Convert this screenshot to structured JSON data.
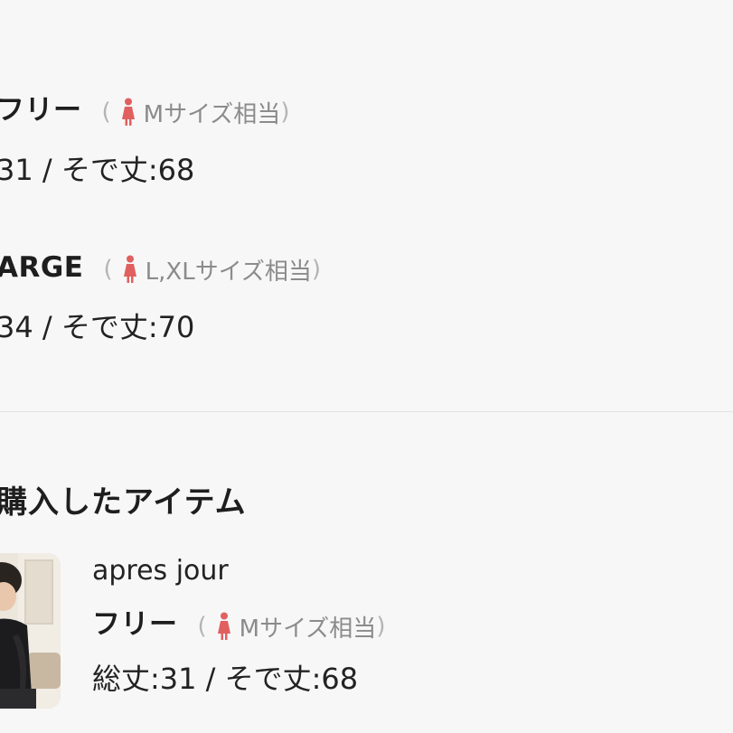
{
  "size_options": [
    {
      "name": "フリー",
      "equivalent_prefix": "(",
      "equivalent": "Mサイズ相当",
      "equivalent_suffix": ")",
      "measurements": "31 / そで丈:68"
    },
    {
      "name": "ARGE",
      "equivalent_prefix": "(",
      "equivalent": "L,XLサイズ相当",
      "equivalent_suffix": ")",
      "measurements": "34 / そで丈:70"
    }
  ],
  "purchased": {
    "section_title": "購入したアイテム",
    "item": {
      "brand": "apres jour",
      "size_name": "フリー",
      "equivalent_prefix": "(",
      "equivalent": "Mサイズ相当",
      "equivalent_suffix": ")",
      "measurements": "総丈:31 / そで丈:68"
    }
  },
  "icons": {
    "person": "person-figure-icon",
    "person_color": "#e06060"
  }
}
